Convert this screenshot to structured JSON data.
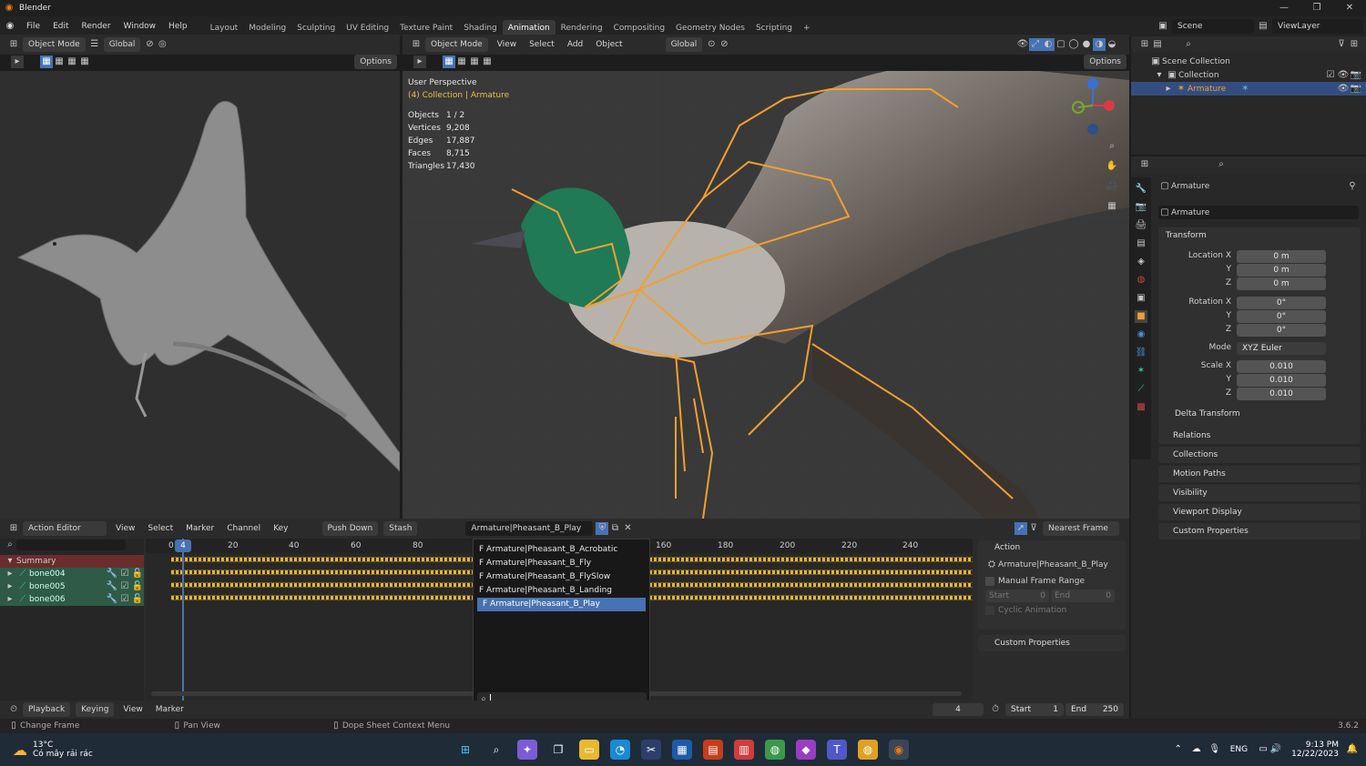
{
  "window": {
    "title": "Blender"
  },
  "menu": [
    "File",
    "Edit",
    "Render",
    "Window",
    "Help"
  ],
  "workspaces": [
    "Layout",
    "Modeling",
    "Sculpting",
    "UV Editing",
    "Texture Paint",
    "Shading",
    "Animation",
    "Rendering",
    "Compositing",
    "Geometry Nodes",
    "Scripting"
  ],
  "active_workspace": "Animation",
  "scene": {
    "name": "Scene",
    "view_layer": "ViewLayer"
  },
  "left_view": {
    "mode": "Object Mode",
    "orientation": "Global",
    "options": "Options"
  },
  "main_view": {
    "mode": "Object Mode",
    "menus": [
      "View",
      "Select",
      "Add",
      "Object"
    ],
    "orientation": "Global",
    "options": "Options",
    "overlay_title": "User Perspective",
    "overlay_sub": "(4) Collection | Armature",
    "stats": [
      {
        "k": "Objects",
        "v": "1 / 2"
      },
      {
        "k": "Vertices",
        "v": "9,208"
      },
      {
        "k": "Edges",
        "v": "17,887"
      },
      {
        "k": "Faces",
        "v": "8,715"
      },
      {
        "k": "Triangles",
        "v": "17,430"
      }
    ]
  },
  "outliner": {
    "root": "Scene Collection",
    "collection": "Collection",
    "object": "Armature"
  },
  "properties": {
    "object": "Armature",
    "data_name": "Armature",
    "transform": "Transform",
    "location": {
      "label": "Location X",
      "x": "0 m",
      "y": "0 m",
      "z": "0 m"
    },
    "rotation": {
      "label": "Rotation X",
      "x": "0°",
      "y": "0°",
      "z": "0°"
    },
    "mode_label": "Mode",
    "mode": "XYZ Euler",
    "scale": {
      "label": "Scale X",
      "x": "0.010",
      "y": "0.010",
      "z": "0.010"
    },
    "axis_y": "Y",
    "axis_z": "Z",
    "sections": [
      "Delta Transform",
      "Relations",
      "Collections",
      "Motion Paths",
      "Visibility",
      "Viewport Display",
      "Custom Properties"
    ]
  },
  "dopesheet": {
    "editor": "Action Editor",
    "menus": [
      "View",
      "Select",
      "Marker",
      "Channel",
      "Key"
    ],
    "push_down": "Push Down",
    "stash": "Stash",
    "action": "Armature|Pheasant_B_Play",
    "snap": "Nearest Frame",
    "ticks": [
      "0",
      "20",
      "40",
      "60",
      "80",
      "160",
      "180",
      "200",
      "220",
      "240"
    ],
    "current_frame": "4",
    "channels": [
      "Summary",
      "bone004",
      "bone005",
      "bone006"
    ]
  },
  "action_list": [
    "Armature|Pheasant_B_Acrobatic",
    "Armature|Pheasant_B_Fly",
    "Armature|Pheasant_B_FlySlow",
    "Armature|Pheasant_B_Landing",
    "Armature|Pheasant_B_Play"
  ],
  "action_panel": {
    "title": "Action",
    "action": "Armature|Pheasant_B_Play",
    "manual": "Manual Frame Range",
    "start_label": "Start",
    "start": "0",
    "end_label": "End",
    "end": "0",
    "cyclic": "Cyclic Animation",
    "custom": "Custom Properties"
  },
  "timeline": {
    "playback": "Playback",
    "keying": "Keying",
    "view": "View",
    "marker": "Marker",
    "frame": "4",
    "start_label": "Start",
    "start": "1",
    "end_label": "End",
    "end": "250"
  },
  "status": {
    "change_frame": "Change Frame",
    "pan_view": "Pan View",
    "context": "Dope Sheet Context Menu",
    "version": "3.6.2"
  },
  "taskbar": {
    "temp": "13°C",
    "weather": "Có mây rải rác",
    "lang": "ENG",
    "time": "9:13 PM",
    "date": "12/22/2023"
  },
  "colors": {
    "accent": "#4772b3",
    "bone": "#f0a030",
    "keyframe": "#e6b432",
    "active_ws": "#3a3a3a"
  }
}
